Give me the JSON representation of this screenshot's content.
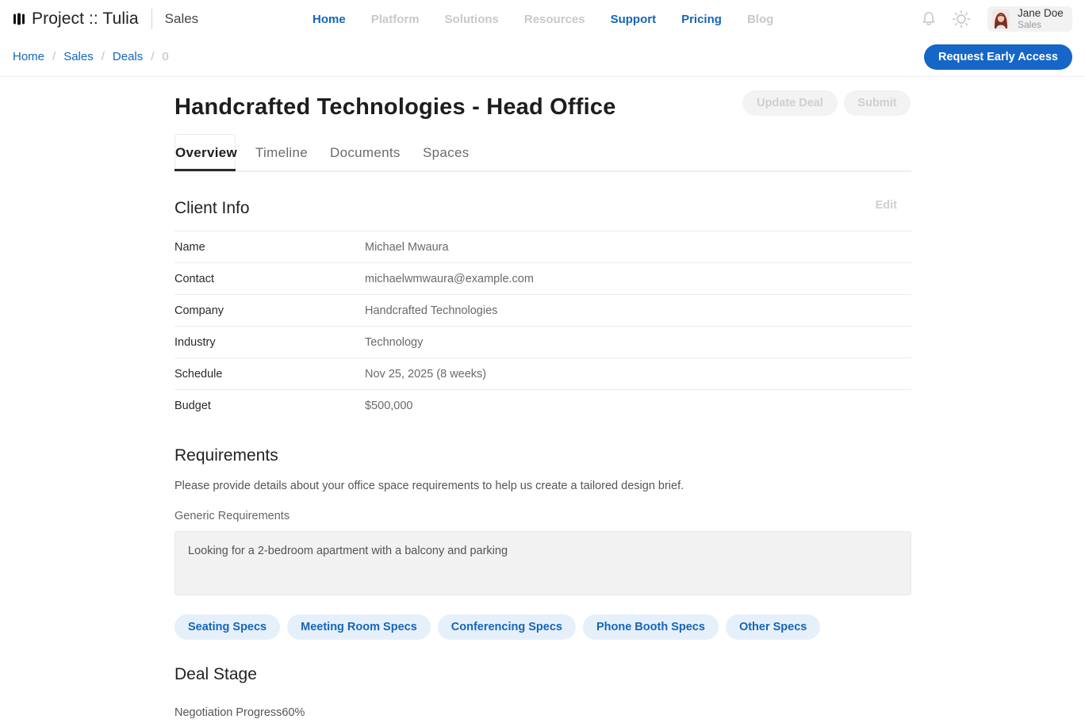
{
  "header": {
    "brand": "Project :: Tulia",
    "section": "Sales",
    "nav": [
      {
        "label": "Home",
        "active": true
      },
      {
        "label": "Platform",
        "active": false
      },
      {
        "label": "Solutions",
        "active": false
      },
      {
        "label": "Resources",
        "active": false
      },
      {
        "label": "Support",
        "active": true
      },
      {
        "label": "Pricing",
        "active": true
      },
      {
        "label": "Blog",
        "active": false
      }
    ],
    "icons": {
      "notifications": "bell-icon",
      "theme": "sun-icon"
    },
    "user": {
      "name": "Jane Doe",
      "role": "Sales"
    }
  },
  "breadcrumb": {
    "items": [
      "Home",
      "Sales",
      "Deals"
    ],
    "current": "0",
    "separator": "/"
  },
  "cta": {
    "label": "Request Early Access"
  },
  "page": {
    "title": "Handcrafted Technologies - Head Office",
    "actions": {
      "update": "Update Deal",
      "submit": "Submit"
    },
    "tabs": [
      "Overview",
      "Timeline",
      "Documents",
      "Spaces"
    ],
    "active_tab": "Overview"
  },
  "client_info": {
    "title": "Client Info",
    "edit_label": "Edit",
    "rows": [
      {
        "key": "Name",
        "value": "Michael Mwaura"
      },
      {
        "key": "Contact",
        "value": "michaelwmwaura@example.com"
      },
      {
        "key": "Company",
        "value": "Handcrafted Technologies"
      },
      {
        "key": "Industry",
        "value": "Technology"
      },
      {
        "key": "Schedule",
        "value": "Nov 25, 2025 (8 weeks)"
      },
      {
        "key": "Budget",
        "value": "$500,000"
      }
    ]
  },
  "requirements": {
    "title": "Requirements",
    "description": "Please provide details about your office space requirements to help us create a tailored design brief.",
    "generic_label": "Generic Requirements",
    "generic_value": "Looking for a 2-bedroom apartment with a balcony and parking",
    "specs": [
      "Seating Specs",
      "Meeting Room Specs",
      "Conferencing Specs",
      "Phone Booth Specs",
      "Other Specs"
    ]
  },
  "deal_stage": {
    "title": "Deal Stage",
    "progress_label": "Negotiation Progress",
    "progress_value": "60%"
  },
  "colors": {
    "accent": "#1566b8",
    "cta": "#1566c7",
    "chip_bg": "#e6f0fb"
  }
}
